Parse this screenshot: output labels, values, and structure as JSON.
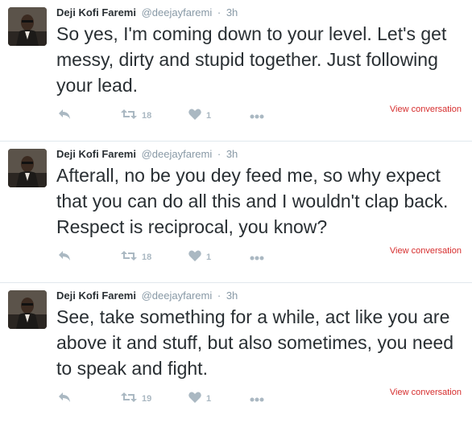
{
  "tweets": [
    {
      "fullname": "Deji Kofi Faremi",
      "username": "@deejayfaremi",
      "separator": "·",
      "time": "3h",
      "text": "So yes, I'm coming down to your level. Let's get messy, dirty and stupid together. Just following your lead.",
      "retweets": "18",
      "likes": "1",
      "view_conversation": "View conversation"
    },
    {
      "fullname": "Deji Kofi Faremi",
      "username": "@deejayfaremi",
      "separator": "·",
      "time": "3h",
      "text": "Afterall, no be you dey feed me, so why expect that you can do all this and I wouldn't clap back. Respect is reciprocal, you know?",
      "retweets": "18",
      "likes": "1",
      "view_conversation": "View conversation"
    },
    {
      "fullname": "Deji Kofi Faremi",
      "username": "@deejayfaremi",
      "separator": "·",
      "time": "3h",
      "text": "See, take something for a while, act like you are above it and stuff, but also sometimes, you need to speak and fight.",
      "retweets": "19",
      "likes": "1",
      "view_conversation": "View conversation"
    }
  ],
  "icons": {
    "reply": "reply-icon",
    "retweet": "retweet-icon",
    "like": "heart-icon",
    "more": "more-icon"
  },
  "colors": {
    "text": "#292f33",
    "muted": "#8899a6",
    "action_icon": "#aab8c2",
    "view_conversation": "#d62d2d",
    "divider": "#e1e8ed"
  }
}
